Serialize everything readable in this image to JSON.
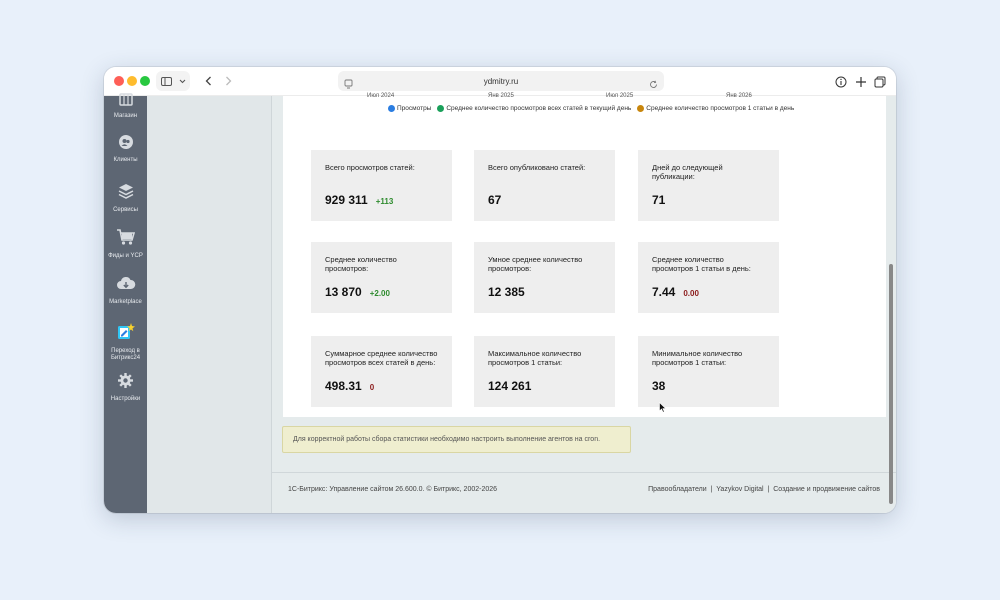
{
  "browser": {
    "url": "ydmitry.ru"
  },
  "sidebar": {
    "items": [
      {
        "label": "Магазин",
        "icon": "shop-icon"
      },
      {
        "label": "Клиенты",
        "icon": "clients-icon"
      },
      {
        "label": "Сервисы",
        "icon": "services-icon"
      },
      {
        "label": "Фиды и YCP",
        "icon": "cart-icon"
      },
      {
        "label": "Marketplace",
        "icon": "cloud-download-icon"
      },
      {
        "label": "Переход в Битрикс24",
        "icon": "bitrix24-icon"
      },
      {
        "label": "Настройки",
        "icon": "gear-icon"
      }
    ]
  },
  "chart_axis": {
    "ticks": [
      "Июл 2024",
      "Янв 2025",
      "Июл 2025",
      "Янв 2026"
    ]
  },
  "legend": {
    "items": [
      {
        "label": "Просмотры",
        "color": "#2a7de1"
      },
      {
        "label": "Среднее количество просмотров всех статей в текущий день",
        "color": "#1aa05a"
      },
      {
        "label": "Среднее количество просмотров 1 статьи в день",
        "color": "#c8860d"
      }
    ]
  },
  "cards": [
    {
      "label": "Всего просмотров статей:",
      "value": "929 311",
      "delta": "+113",
      "delta_color": "green"
    },
    {
      "label": "Всего опубликовано статей:",
      "value": "67",
      "delta": "",
      "delta_color": ""
    },
    {
      "label": "Дней до следующей публикации:",
      "value": "71",
      "delta": "",
      "delta_color": ""
    },
    {
      "label": "Среднее количество просмотров:",
      "value": "13 870",
      "delta": "+2.00",
      "delta_color": "green"
    },
    {
      "label": "Умное среднее количество просмотров:",
      "value": "12 385",
      "delta": "",
      "delta_color": ""
    },
    {
      "label": "Среднее количество просмотров 1 статьи в день:",
      "value": "7.44",
      "delta": "0.00",
      "delta_color": "red"
    },
    {
      "label": "Суммарное среднее количество просмотров всех статей в день:",
      "value": "498.31",
      "delta": "0",
      "delta_color": "red"
    },
    {
      "label": "Максимальное количество просмотров 1 статьи:",
      "value": "124 261",
      "delta": "",
      "delta_color": ""
    },
    {
      "label": "Минимальное количество просмотров 1 статьи:",
      "value": "38",
      "delta": "",
      "delta_color": ""
    }
  ],
  "notice": {
    "text": "Для корректной работы сбора статистики необходимо настроить выполнение агентов на cron."
  },
  "footer": {
    "left": "1С-Битрикс: Управление сайтом 26.600.0. © Битрикс, 2002-2026",
    "right_links": [
      "Правообладатели",
      "Yazykov Digital",
      "Создание и продвижение сайтов"
    ]
  }
}
